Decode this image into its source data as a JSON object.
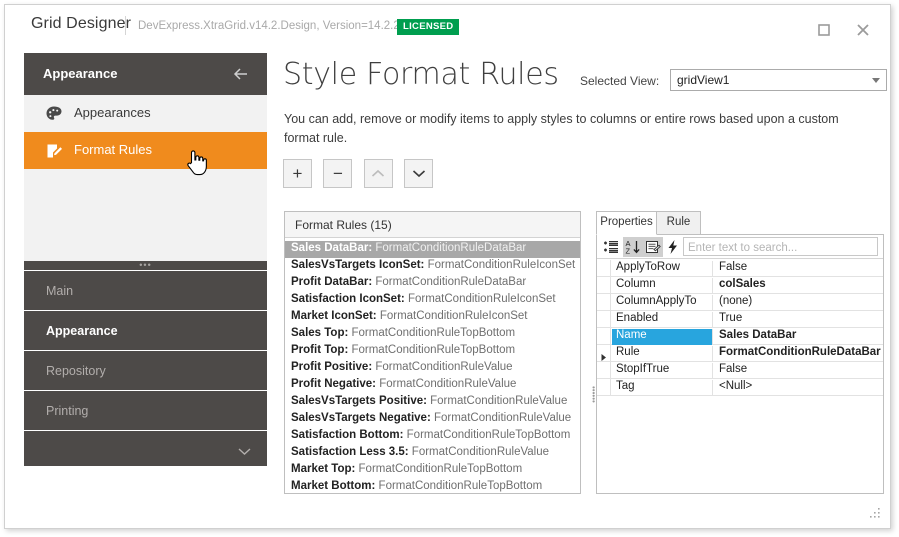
{
  "window": {
    "app_title": "Grid Designer",
    "assembly": "DevExpress.XtraGrid.v14.2.Design, Version=14.2.2.0",
    "license_badge": "LICENSED",
    "maximize_icon": "maximize-icon",
    "close_icon": "close-icon",
    "accent_orange": "#F08B1D",
    "dark_gray": "#4D4A48",
    "license_green": "#009E4F",
    "selection_blue": "#28A5DE"
  },
  "sidebar": {
    "header_title": "Appearance",
    "back_icon": "arrow-left-icon",
    "items": [
      {
        "label": "Appearances",
        "icon": "palette-icon",
        "active": false
      },
      {
        "label": "Format Rules",
        "icon": "edit-document-icon",
        "active": true
      }
    ],
    "nav": [
      {
        "label": "Main",
        "current": false
      },
      {
        "label": "Appearance",
        "current": true
      },
      {
        "label": "Repository",
        "current": false
      },
      {
        "label": "Printing",
        "current": false
      }
    ],
    "more_icon": "chevron-down-icon"
  },
  "content": {
    "page_title": "Style Format Rules",
    "selected_view_label": "Selected View:",
    "selected_view_value": "gridView1",
    "description": "You can add, remove or modify items to apply styles to columns or entire rows based upon a custom format rule.",
    "toolbar": [
      {
        "name": "add-rule-button",
        "glyph": "+",
        "disabled": false
      },
      {
        "name": "remove-rule-button",
        "glyph": "−",
        "disabled": false
      },
      {
        "name": "move-up-button",
        "glyph": "⌃",
        "disabled": true
      },
      {
        "name": "move-down-button",
        "glyph": "⌄",
        "disabled": false
      }
    ]
  },
  "rules_panel": {
    "header": "Format Rules (15)",
    "rules": [
      {
        "name": "Sales DataBar",
        "type": "FormatConditionRuleDataBar",
        "selected": true
      },
      {
        "name": "SalesVsTargets IconSet",
        "type": "FormatConditionRuleIconSet",
        "selected": false
      },
      {
        "name": "Profit DataBar",
        "type": "FormatConditionRuleDataBar",
        "selected": false
      },
      {
        "name": "Satisfaction IconSet",
        "type": "FormatConditionRuleIconSet",
        "selected": false
      },
      {
        "name": "Market IconSet",
        "type": "FormatConditionRuleIconSet",
        "selected": false
      },
      {
        "name": "Sales Top",
        "type": "FormatConditionRuleTopBottom",
        "selected": false
      },
      {
        "name": "Profit Top",
        "type": "FormatConditionRuleTopBottom",
        "selected": false
      },
      {
        "name": "Profit Positive",
        "type": "FormatConditionRuleValue",
        "selected": false
      },
      {
        "name": "Profit Negative",
        "type": "FormatConditionRuleValue",
        "selected": false
      },
      {
        "name": "SalesVsTargets Positive",
        "type": "FormatConditionRuleValue",
        "selected": false
      },
      {
        "name": "SalesVsTargets Negative",
        "type": "FormatConditionRuleValue",
        "selected": false
      },
      {
        "name": "Satisfaction Bottom",
        "type": "FormatConditionRuleTopBottom",
        "selected": false
      },
      {
        "name": "Satisfaction Less 3.5",
        "type": "FormatConditionRuleValue",
        "selected": false
      },
      {
        "name": "Market Top",
        "type": "FormatConditionRuleTopBottom",
        "selected": false
      },
      {
        "name": "Market Bottom",
        "type": "FormatConditionRuleTopBottom",
        "selected": false
      }
    ]
  },
  "properties_panel": {
    "tabs": [
      {
        "label": "Properties",
        "active": true
      },
      {
        "label": "Rule",
        "active": false
      }
    ],
    "toolbar_icons": [
      {
        "name": "categorized-icon",
        "pressed": false
      },
      {
        "name": "alphabetical-sort-icon",
        "pressed": true
      },
      {
        "name": "properties-page-icon",
        "pressed": true
      },
      {
        "name": "events-lightning-icon",
        "pressed": false
      }
    ],
    "search_placeholder": "Enter text to search...",
    "search_value": "",
    "rows": [
      {
        "name": "ApplyToRow",
        "value": "False",
        "bold": false,
        "selected": false,
        "expandable": false
      },
      {
        "name": "Column",
        "value": "colSales",
        "bold": true,
        "selected": false,
        "expandable": false
      },
      {
        "name": "ColumnApplyTo",
        "value": "(none)",
        "bold": false,
        "selected": false,
        "expandable": false
      },
      {
        "name": "Enabled",
        "value": "True",
        "bold": false,
        "selected": false,
        "expandable": false
      },
      {
        "name": "Name",
        "value": "Sales DataBar",
        "bold": true,
        "selected": true,
        "expandable": false
      },
      {
        "name": "Rule",
        "value": "FormatConditionRuleDataBar",
        "bold": true,
        "selected": false,
        "expandable": true
      },
      {
        "name": "StopIfTrue",
        "value": "False",
        "bold": false,
        "selected": false,
        "expandable": false
      },
      {
        "name": "Tag",
        "value": "<Null>",
        "bold": false,
        "selected": false,
        "expandable": false
      }
    ]
  },
  "resize_grip_icon": "resize-grip-icon"
}
